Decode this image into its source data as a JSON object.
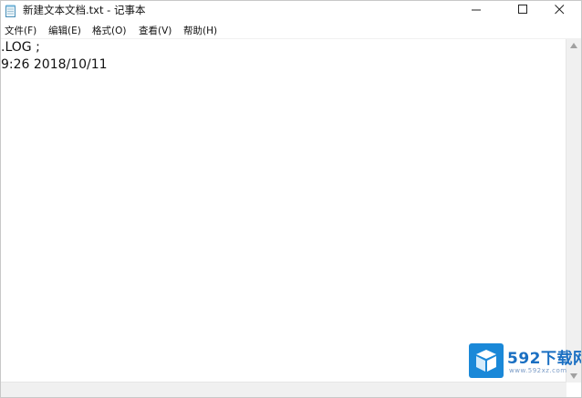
{
  "window": {
    "title": "新建文本文档.txt - 记事本",
    "icon": "notepad-icon"
  },
  "controls": {
    "minimize_icon": "minimize-icon",
    "maximize_icon": "maximize-icon",
    "close_icon": "close-icon"
  },
  "menu": {
    "items": [
      {
        "label": "文件(F)"
      },
      {
        "label": "编辑(E)"
      },
      {
        "label": "格式(O)"
      },
      {
        "label": "查看(V)"
      },
      {
        "label": "帮助(H)"
      }
    ]
  },
  "editor": {
    "lines": [
      ".LOG ;",
      "9:26 2018/10/11"
    ]
  },
  "watermark": {
    "brand": "592下载网",
    "url": "www.592xz.com",
    "accent": "#1a88d8"
  }
}
